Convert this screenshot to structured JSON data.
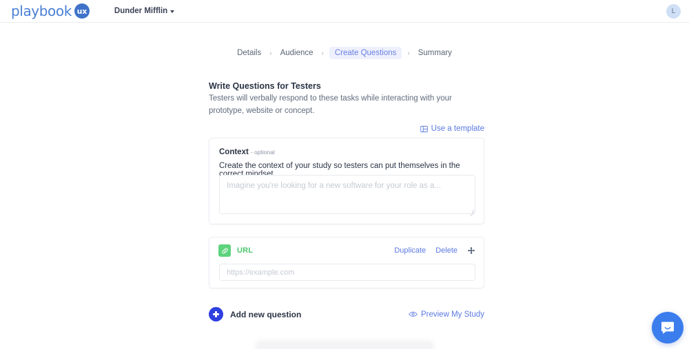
{
  "header": {
    "logo_word": "playbook",
    "logo_badge": "ux",
    "org_name": "Dunder Mifflin",
    "avatar_initial": "L",
    "caret_icon": "chevron-down-icon"
  },
  "breadcrumb": {
    "items": [
      {
        "label": "Details",
        "active": false
      },
      {
        "label": "Audience",
        "active": false
      },
      {
        "label": "Create Questions",
        "active": true
      },
      {
        "label": "Summary",
        "active": false
      }
    ],
    "separator": "›"
  },
  "main": {
    "title": "Write Questions for Testers",
    "description": "Testers will verbally respond to these tasks while interacting with your prototype, website or concept.",
    "template_link": "Use a template",
    "template_icon": "layout-template-icon"
  },
  "context_card": {
    "label": "Context",
    "optional_tag": "- optional",
    "prompt": "Create the context of your study so testers can put themselves in the correct mindset",
    "textarea_placeholder": "Imagine you're looking for a new software for your role as a...",
    "textarea_value": ""
  },
  "url_card": {
    "badge_icon": "link-icon",
    "type_label": "URL",
    "duplicate_label": "Duplicate",
    "delete_label": "Delete",
    "drag_icon": "move-icon",
    "input_placeholder": "https://example.com",
    "input_value": ""
  },
  "footer": {
    "add_question_label": "Add new question",
    "add_icon": "plus-icon",
    "preview_label": "Preview My Study",
    "preview_icon": "eye-icon"
  },
  "chat": {
    "icon": "intercom-messenger-icon"
  },
  "colors": {
    "brand_blue": "#3f72c9",
    "accent_indigo": "#2f3fe0",
    "link_blue": "#5b79e0",
    "active_crumb_text": "#6b7fe3",
    "active_crumb_bg": "#eef1fd",
    "url_green": "#5ed37e",
    "url_green_text": "#4cc56d",
    "text_dark": "#2b3445",
    "text_muted": "#5f6b7c",
    "placeholder": "#c5cad3",
    "border": "#ebedf2",
    "intercom_blue": "#3b7ded"
  }
}
